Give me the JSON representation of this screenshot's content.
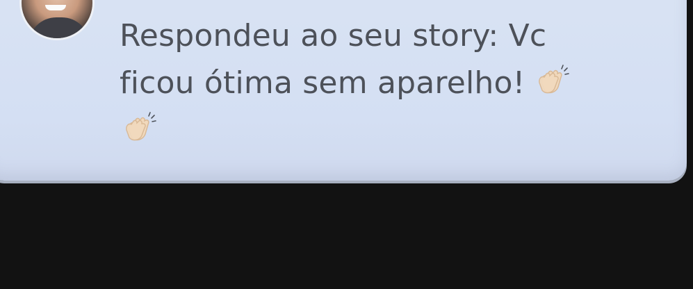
{
  "notification": {
    "message_text": "Respondeu ao seu story: Vc ficou ótima sem aparelho!",
    "emojis": [
      "clapping-hands",
      "clapping-hands"
    ]
  },
  "colors": {
    "background": "#121212",
    "card": "#d6e0f3",
    "text": "#4d5159"
  }
}
